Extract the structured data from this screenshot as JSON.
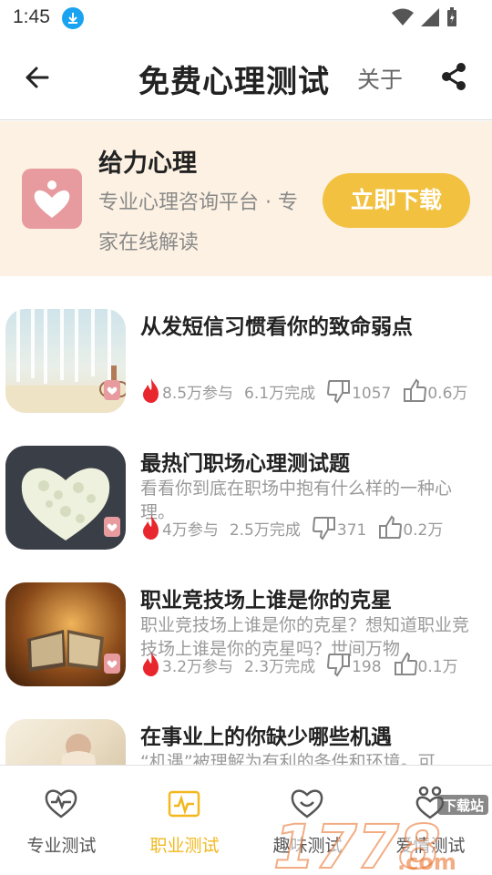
{
  "status": {
    "time": "1:45"
  },
  "header": {
    "title": "免费心理测试",
    "about": "关于"
  },
  "banner": {
    "app_name": "给力心理",
    "app_desc": "专业心理咨询平台 · 专家在线解读",
    "download_label": "立即下载"
  },
  "tests": [
    {
      "title": "从发短信习惯看你的致命弱点",
      "desc": "",
      "participants": "8.5万参与",
      "completed": "6.1万完成",
      "dislikes": "1057",
      "likes": "0.6万"
    },
    {
      "title": "最热门职场心理测试题",
      "desc": "看看你到底在职场中抱有什么样的一种心理。",
      "participants": "4万参与",
      "completed": "2.5万完成",
      "dislikes": "371",
      "likes": "0.2万"
    },
    {
      "title": "职业竞技场上谁是你的克星",
      "desc": "职业竞技场上谁是你的克星？想知道职业竞技场上谁是你的克星吗？世间万物",
      "participants": "3.2万参与",
      "completed": "2.3万完成",
      "dislikes": "198",
      "likes": "0.1万"
    },
    {
      "title": "在事业上的你缺少哪些机遇",
      "desc": "“机遇”被理解为有利的条件和环境。可",
      "participants": "",
      "completed": "",
      "dislikes": "",
      "likes": ""
    }
  ],
  "tabs": [
    {
      "label": "专业测试",
      "icon": "heart-pulse-icon",
      "active": false
    },
    {
      "label": "职业测试",
      "icon": "briefcase-chart-icon",
      "active": true
    },
    {
      "label": "趣味测试",
      "icon": "heart-smile-icon",
      "active": false
    },
    {
      "label": "爱情测试",
      "icon": "couple-heart-icon",
      "active": false
    }
  ],
  "watermark": {
    "text": "1778.com",
    "tag": "下载站"
  },
  "colors": {
    "accent": "#f2c140",
    "active_tab": "#f2b81e",
    "fire": "#e8262d",
    "banner_bg": "#fcf1e2",
    "logo": "#e79b9f"
  }
}
